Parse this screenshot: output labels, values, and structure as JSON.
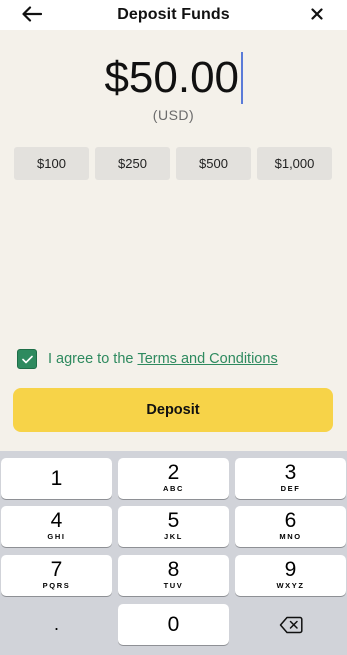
{
  "header": {
    "title": "Deposit Funds",
    "back_icon": "arrow-left-icon",
    "close_icon": "close-icon"
  },
  "amount": {
    "value": "$50.00",
    "currency": "(USD)"
  },
  "presets": [
    {
      "label": "$100"
    },
    {
      "label": "$250"
    },
    {
      "label": "$500"
    },
    {
      "label": "$1,000"
    }
  ],
  "agreement": {
    "checked": true,
    "text": "I agree to the",
    "link": "Terms and Conditions"
  },
  "deposit_button": {
    "label": "Deposit"
  },
  "keypad": {
    "keys": [
      {
        "digit": "1",
        "letters": ""
      },
      {
        "digit": "2",
        "letters": "ABC"
      },
      {
        "digit": "3",
        "letters": "DEF"
      },
      {
        "digit": "4",
        "letters": "GHI"
      },
      {
        "digit": "5",
        "letters": "JKL"
      },
      {
        "digit": "6",
        "letters": "MNO"
      },
      {
        "digit": "7",
        "letters": "PQRS"
      },
      {
        "digit": "8",
        "letters": "TUV"
      },
      {
        "digit": "9",
        "letters": "WXYZ"
      },
      {
        "digit": "0",
        "letters": ""
      }
    ],
    "decimal": ".",
    "backspace_icon": "backspace-icon"
  },
  "colors": {
    "accent_green": "#2e8a5f",
    "button_yellow": "#f7d348",
    "background": "#f4f1ea",
    "keypad_bg": "#d1d3d9"
  }
}
